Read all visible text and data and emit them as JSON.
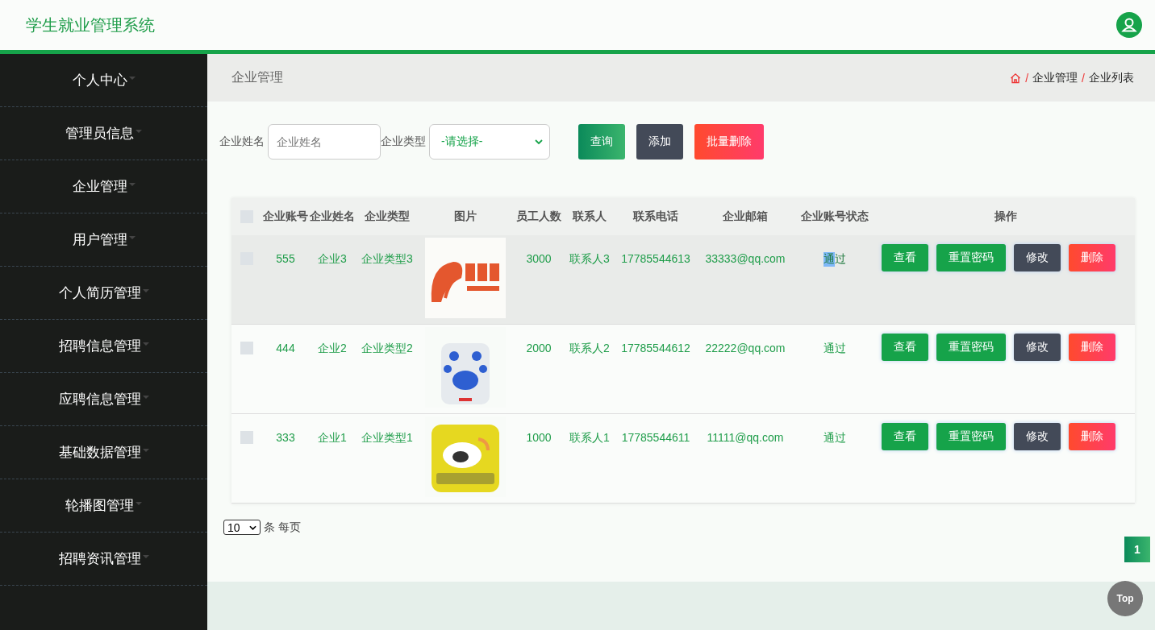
{
  "header": {
    "title": "学生就业管理系统"
  },
  "sidebar": {
    "items": [
      {
        "label": "个人中心"
      },
      {
        "label": "管理员信息"
      },
      {
        "label": "企业管理"
      },
      {
        "label": "用户管理"
      },
      {
        "label": "个人简历管理"
      },
      {
        "label": "招聘信息管理"
      },
      {
        "label": "应聘信息管理"
      },
      {
        "label": "基础数据管理"
      },
      {
        "label": "轮播图管理"
      },
      {
        "label": "招聘资讯管理"
      }
    ]
  },
  "page_title": "企业管理",
  "breadcrumb": [
    {
      "separator": "/",
      "label": "企业管理"
    },
    {
      "separator": "/",
      "label": "企业列表"
    }
  ],
  "search": {
    "fields": [
      {
        "label": "企业姓名",
        "kind": "input",
        "placeholder": "企业姓名"
      },
      {
        "label": "企业类型",
        "kind": "select",
        "value": "-请选择-"
      }
    ],
    "buttons": [
      {
        "label": "查询",
        "kind": "query"
      },
      {
        "label": "添加",
        "kind": "add"
      },
      {
        "label": "批量删除",
        "kind": "delete"
      }
    ]
  },
  "table": {
    "select_all_checked": false,
    "columns": [
      "企业账号",
      "企业姓名",
      "企业类型",
      "图片",
      "员工人数",
      "联系人",
      "联系电话",
      "企业邮箱",
      "企业账号状态",
      "操作"
    ],
    "rows": [
      {
        "hovered": true,
        "checked": false,
        "account": "555",
        "name": "企业3",
        "type": "企业类型3",
        "staff": "3000",
        "contact": "联系人3",
        "phone": "17785544613",
        "email": "33333@qq.com",
        "status": "通过",
        "status_highlighted": true,
        "actions": [
          {
            "label": "查看",
            "kind": "view"
          },
          {
            "label": "重置密码",
            "kind": "reset"
          },
          {
            "label": "修改",
            "kind": "edit"
          },
          {
            "label": "删除",
            "kind": "delete"
          }
        ]
      },
      {
        "hovered": false,
        "checked": false,
        "account": "444",
        "name": "企业2",
        "type": "企业类型2",
        "staff": "2000",
        "contact": "联系人2",
        "phone": "17785544612",
        "email": "22222@qq.com",
        "status": "通过",
        "status_highlighted": false,
        "actions": [
          {
            "label": "查看",
            "kind": "view"
          },
          {
            "label": "重置密码",
            "kind": "reset"
          },
          {
            "label": "修改",
            "kind": "edit"
          },
          {
            "label": "删除",
            "kind": "delete"
          }
        ]
      },
      {
        "hovered": false,
        "checked": false,
        "account": "333",
        "name": "企业1",
        "type": "企业类型1",
        "staff": "1000",
        "contact": "联系人1",
        "phone": "17785544611",
        "email": "11111@qq.com",
        "status": "通过",
        "status_highlighted": false,
        "actions": [
          {
            "label": "查看",
            "kind": "view"
          },
          {
            "label": "重置密码",
            "kind": "reset"
          },
          {
            "label": "修改",
            "kind": "edit"
          },
          {
            "label": "删除",
            "kind": "delete"
          }
        ]
      }
    ]
  },
  "pagination": {
    "page_size": "10",
    "page_size_label": "条 每页",
    "pages": [
      {
        "label": "1",
        "selected": true
      }
    ]
  },
  "top_button": "Top"
}
